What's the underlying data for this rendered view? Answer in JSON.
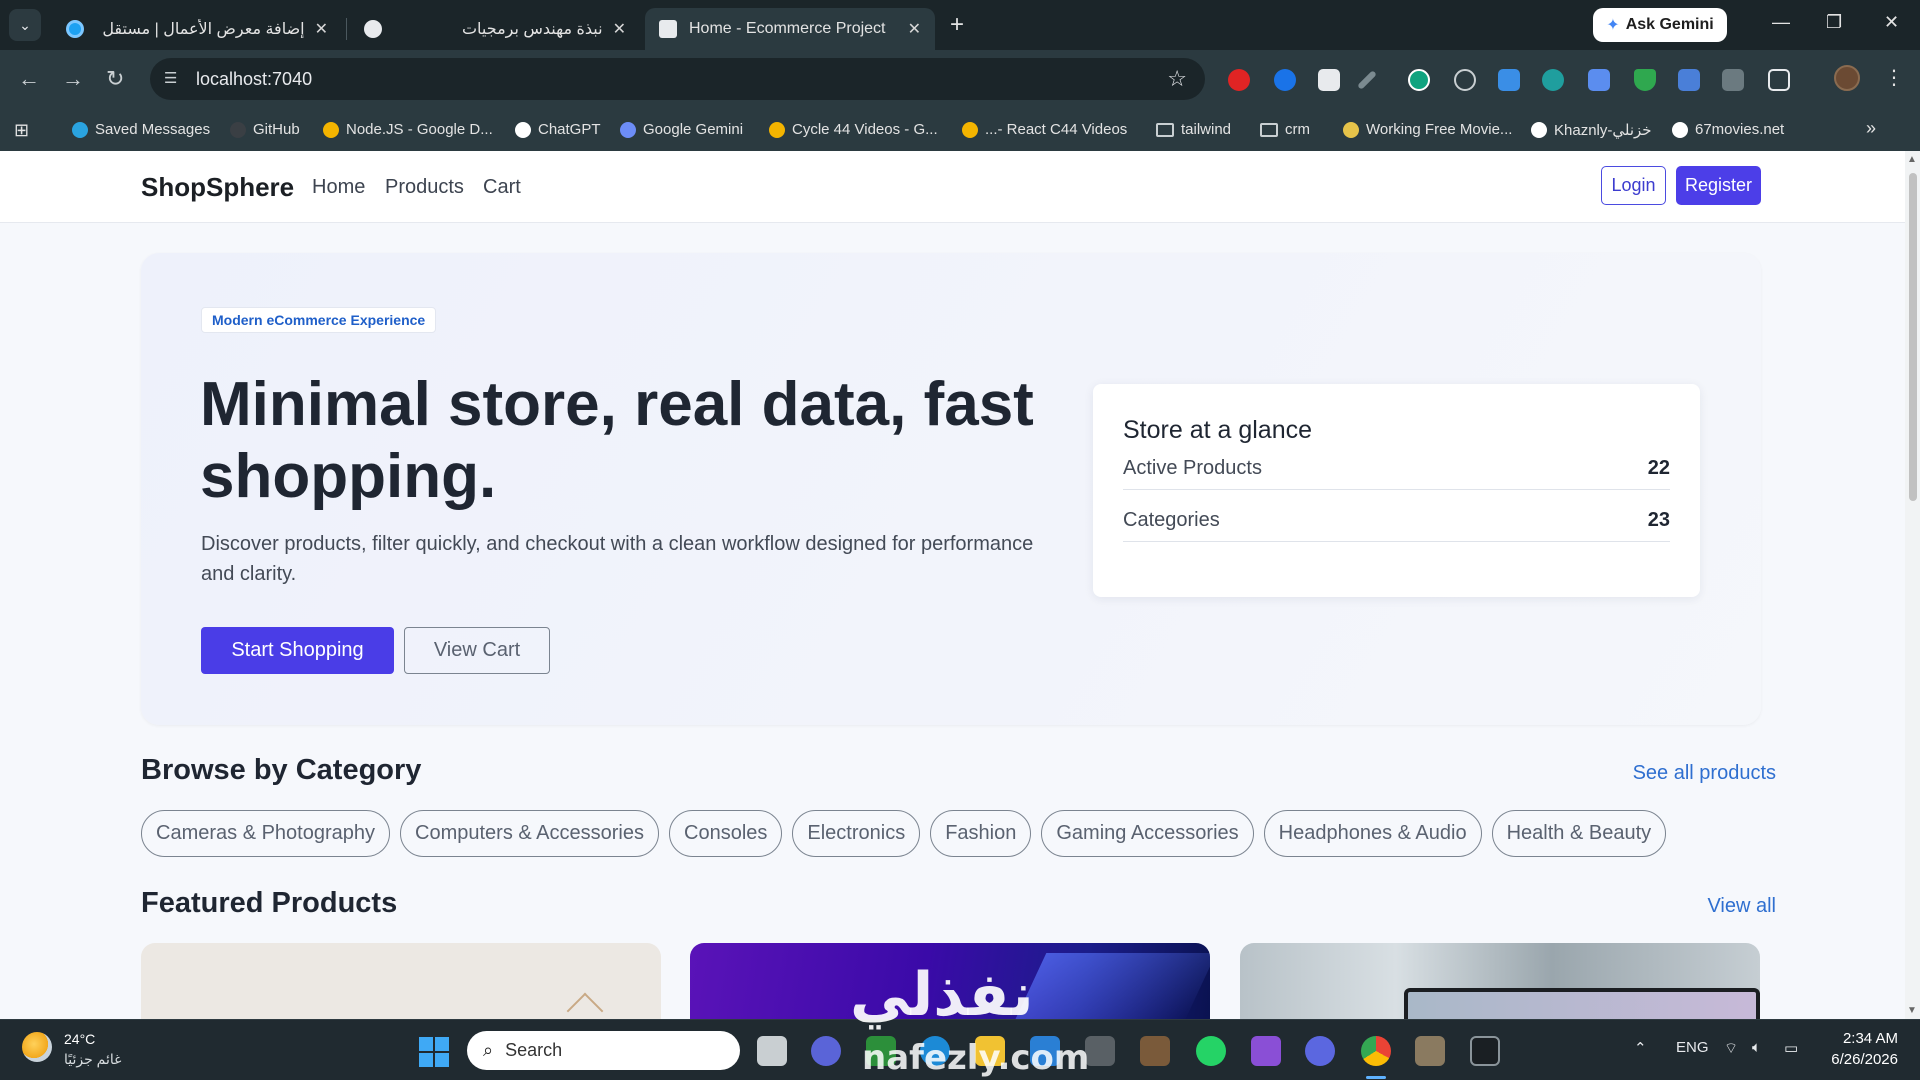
{
  "browser": {
    "tabs": [
      {
        "title": "إضافة معرض الأعمال | مستقل",
        "favicon_color": "#1da1f2"
      },
      {
        "title": "نبذة مهندس برمجيات",
        "favicon_color": "#e8eaed"
      },
      {
        "title": "Home - Ecommerce Project",
        "favicon_color": "#e8eaed",
        "active": true
      }
    ],
    "close_glyph": "✕",
    "new_tab_glyph": "+",
    "ask_gemini": "Ask Gemini",
    "url": "localhost:7040",
    "bookmarks": [
      {
        "label": "Saved Messages",
        "icon": "telegram-icon",
        "color": "#2aa3e0"
      },
      {
        "label": "GitHub",
        "icon": "github-icon",
        "color": "#3a3f44"
      },
      {
        "label": "Node.JS - Google D...",
        "icon": "drive-icon",
        "color": "#f4b400"
      },
      {
        "label": "ChatGPT",
        "icon": "chatgpt-icon",
        "color": "#ffffff"
      },
      {
        "label": "Google Gemini",
        "icon": "gemini-icon",
        "color": "#6d8df7"
      },
      {
        "label": "Cycle 44 Videos - G...",
        "icon": "drive-icon",
        "color": "#f4b400"
      },
      {
        "label": "...- React C44 Videos",
        "icon": "drive-icon",
        "color": "#f4b400"
      },
      {
        "label": "tailwind",
        "icon": "folder-icon",
        "color": "#c9cfd2"
      },
      {
        "label": "crm",
        "icon": "folder-icon",
        "color": "#c9cfd2"
      },
      {
        "label": "Working Free Movie...",
        "icon": "movie-icon",
        "color": "#e6c34a"
      },
      {
        "label": "Khaznly-خزنلي",
        "icon": "khaznly-icon",
        "color": "#ffffff"
      },
      {
        "label": "67movies.net",
        "icon": "movies-icon",
        "color": "#ffffff"
      }
    ]
  },
  "site": {
    "brand": "ShopSphere",
    "nav": [
      "Home",
      "Products",
      "Cart"
    ],
    "login": "Login",
    "register": "Register",
    "hero": {
      "badge": "Modern eCommerce Experience",
      "title": "Minimal store, real data, fast shopping.",
      "description": "Discover products, filter quickly, and checkout with a clean workflow designed for performance and clarity.",
      "primary_cta": "Start Shopping",
      "secondary_cta": "View Cart"
    },
    "glance": {
      "title": "Store at a glance",
      "rows": [
        {
          "label": "Active Products",
          "value": "22"
        },
        {
          "label": "Categories",
          "value": "23"
        }
      ]
    },
    "categories_section": {
      "title": "Browse by Category",
      "link": "See all products",
      "chips": [
        "Cameras & Photography",
        "Computers & Accessories",
        "Consoles",
        "Electronics",
        "Fashion",
        "Gaming Accessories",
        "Headphones & Audio",
        "Health & Beauty"
      ]
    },
    "featured_section": {
      "title": "Featured Products",
      "link": "View all"
    }
  },
  "taskbar": {
    "weather_temp": "24°C",
    "weather_condition": "غائم جزئيًا",
    "search_placeholder": "Search",
    "language": "ENG",
    "time": "2:34 AM",
    "date": "6/26/2026"
  },
  "watermark": {
    "arabic": "نفذلي",
    "latin": "nafezly.com"
  }
}
